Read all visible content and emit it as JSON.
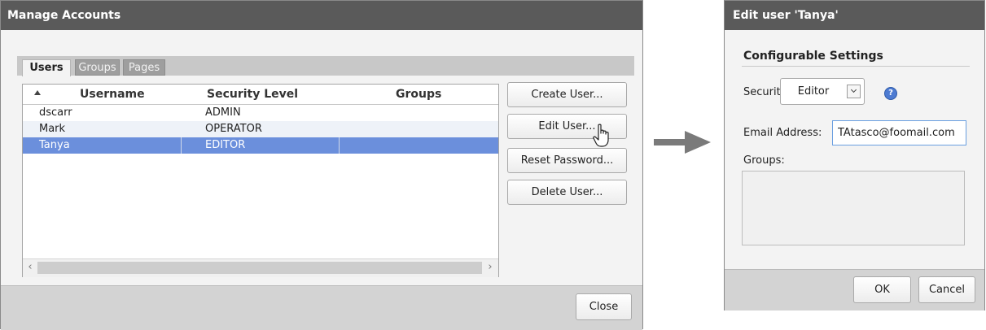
{
  "manage": {
    "title": "Manage Accounts",
    "tabs": [
      {
        "label": "Users",
        "active": true
      },
      {
        "label": "Groups",
        "active": false
      },
      {
        "label": "Pages",
        "active": false
      }
    ],
    "columns": [
      "Username",
      "Security Level",
      "Groups"
    ],
    "rows": [
      {
        "username": "dscarr",
        "level": "ADMIN",
        "selected": false
      },
      {
        "username": "Mark",
        "level": "OPERATOR",
        "selected": false
      },
      {
        "username": "Tanya",
        "level": "EDITOR",
        "selected": true
      }
    ],
    "buttons": {
      "create": "Create User...",
      "edit": "Edit User...",
      "reset": "Reset Password...",
      "delete": "Delete User...",
      "close": "Close"
    }
  },
  "edit": {
    "title": "Edit user 'Tanya'",
    "section": "Configurable Settings",
    "security_label": "Security Level:",
    "security_value": "Editor",
    "email_label": "Email Address:",
    "email_value": "TAtasco@foomail.com",
    "groups_label": "Groups:",
    "ok": "OK",
    "cancel": "Cancel"
  },
  "colors": {
    "titlebar": "#5a5a5a",
    "selected_row": "#6b8fdc",
    "help_icon": "#4d7bd2"
  }
}
